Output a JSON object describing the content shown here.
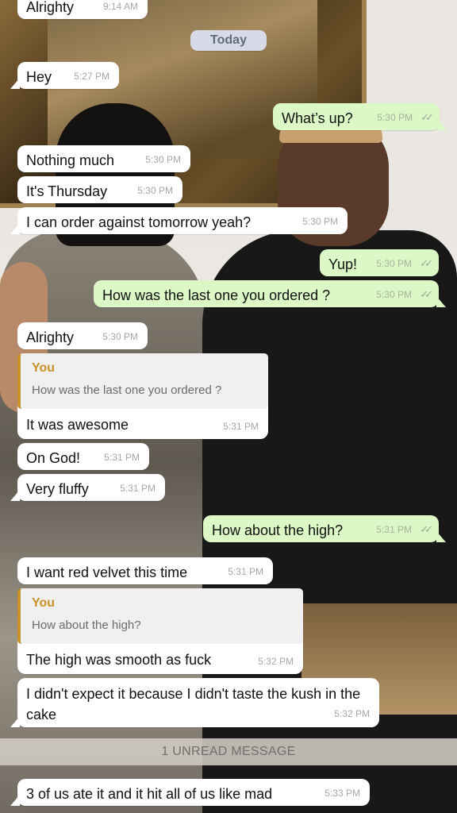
{
  "date_separator": "Today",
  "unread_divider": "1 UNREAD MESSAGE",
  "messages": [
    {
      "text": "Alrighty",
      "time": "9:14 AM"
    },
    {
      "text": "Hey",
      "time": "5:27 PM"
    },
    {
      "text": "What’s up?",
      "time": "5:30 PM"
    },
    {
      "text": "Nothing much",
      "time": "5:30 PM"
    },
    {
      "text": "It's Thursday",
      "time": "5:30 PM"
    },
    {
      "text": "I can order against tomorrow yeah?",
      "time": "5:30 PM"
    },
    {
      "text": "Yup!",
      "time": "5:30 PM"
    },
    {
      "text": "How was the last one you ordered ?",
      "time": "5:30 PM"
    },
    {
      "text": "Alrighty",
      "time": "5:30 PM"
    },
    {
      "quote_author": "You",
      "quote_text": "How was the last one you ordered ?",
      "text": "It was awesome",
      "time": "5:31 PM"
    },
    {
      "text": "On God!",
      "time": "5:31 PM"
    },
    {
      "text": "Very fluffy",
      "time": "5:31 PM"
    },
    {
      "text": "How about the high?",
      "time": "5:31 PM"
    },
    {
      "text": "I want red velvet this time",
      "time": "5:31 PM"
    },
    {
      "quote_author": "You",
      "quote_text": "How about the high?",
      "text": "The high was smooth as fuck",
      "time": "5:32 PM"
    },
    {
      "text": "I didn't expect it because I didn't taste the kush in the cake",
      "time": "5:32 PM"
    },
    {
      "text": "3 of us ate it and it hit all of us like mad",
      "time": "5:33 PM"
    }
  ],
  "read_receipt_icon": "double-check-icon",
  "colors": {
    "incoming_bubble": "#ffffff",
    "outgoing_bubble": "#dcf8c6",
    "quote_accent": "#c8912a",
    "date_pill": "#d7dbe8"
  }
}
